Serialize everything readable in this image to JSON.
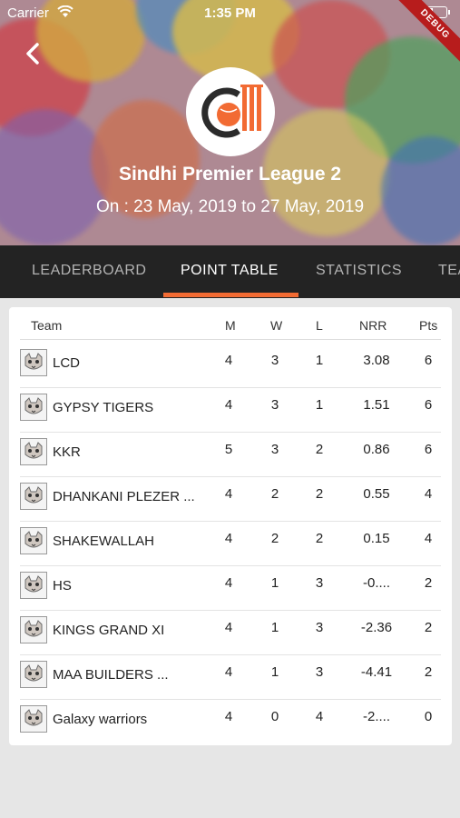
{
  "status": {
    "carrier": "Carrier",
    "time": "1:35 PM",
    "debug": "DEBUG"
  },
  "header": {
    "league": "Sindhi Premier League 2",
    "dates": "On : 23 May, 2019 to 27 May, 2019"
  },
  "tabs": [
    {
      "label": "LEADERBOARD"
    },
    {
      "label": "POINT TABLE"
    },
    {
      "label": "STATISTICS"
    },
    {
      "label": "TEA"
    }
  ],
  "active_tab": "POINT TABLE",
  "table": {
    "headers": {
      "team": "Team",
      "m": "M",
      "w": "W",
      "l": "L",
      "nrr": "NRR",
      "pts": "Pts"
    },
    "rows": [
      {
        "team": "LCD",
        "m": "4",
        "w": "3",
        "l": "1",
        "nrr": "3.08",
        "pts": "6"
      },
      {
        "team": "GYPSY TIGERS",
        "m": "4",
        "w": "3",
        "l": "1",
        "nrr": "1.51",
        "pts": "6"
      },
      {
        "team": "KKR",
        "m": "5",
        "w": "3",
        "l": "2",
        "nrr": "0.86",
        "pts": "6"
      },
      {
        "team": "DHANKANI PLEZER ...",
        "m": "4",
        "w": "2",
        "l": "2",
        "nrr": "0.55",
        "pts": "4"
      },
      {
        "team": "SHAKEWALLAH",
        "m": "4",
        "w": "2",
        "l": "2",
        "nrr": "0.15",
        "pts": "4"
      },
      {
        "team": "HS",
        "m": "4",
        "w": "1",
        "l": "3",
        "nrr": "-0....",
        "pts": "2"
      },
      {
        "team": "KINGS GRAND XI",
        "m": "4",
        "w": "1",
        "l": "3",
        "nrr": "-2.36",
        "pts": "2"
      },
      {
        "team": "MAA BUILDERS ...",
        "m": "4",
        "w": "1",
        "l": "3",
        "nrr": "-4.41",
        "pts": "2"
      },
      {
        "team": "Galaxy warriors",
        "m": "4",
        "w": "0",
        "l": "4",
        "nrr": "-2....",
        "pts": "0"
      }
    ]
  },
  "colors": {
    "accent": "#f26b33",
    "tabbar": "#232323",
    "background": "#e6e6e6"
  }
}
